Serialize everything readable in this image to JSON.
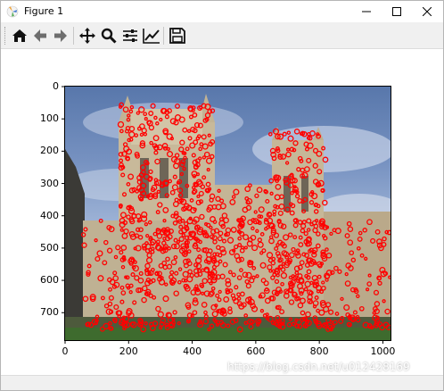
{
  "window": {
    "title": "Figure 1",
    "controls": [
      "minimize",
      "maximize",
      "close"
    ]
  },
  "toolbar": {
    "buttons": [
      {
        "name": "home",
        "icon": "home-icon"
      },
      {
        "name": "back",
        "icon": "arrow-left-icon"
      },
      {
        "name": "forward",
        "icon": "arrow-right-icon"
      },
      {
        "name": "pan",
        "icon": "move-icon"
      },
      {
        "name": "zoom",
        "icon": "magnifier-icon"
      },
      {
        "name": "configure-subplots",
        "icon": "sliders-icon"
      },
      {
        "name": "edit-axes",
        "icon": "line-chart-icon"
      },
      {
        "name": "save",
        "icon": "floppy-disk-icon"
      }
    ]
  },
  "figure": {
    "image_description": "cathedral photograph with red keypoint markers",
    "marker_color": "#ff0000",
    "x_ticks": [
      "0",
      "200",
      "400",
      "600",
      "800",
      "1000"
    ],
    "y_ticks": [
      "0",
      "100",
      "200",
      "300",
      "400",
      "500",
      "600",
      "700"
    ],
    "x_range": [
      0,
      1024
    ],
    "y_range": [
      0,
      785
    ]
  },
  "watermark": "https://blog.csdn.net/u012428169"
}
